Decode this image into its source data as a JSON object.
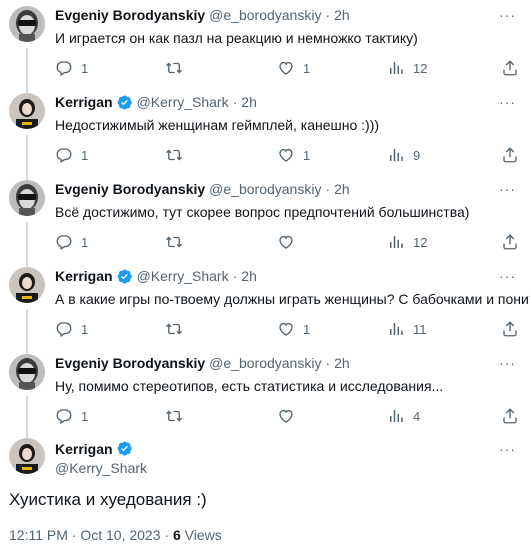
{
  "users": {
    "evgeniy": {
      "name": "Evgeniy Borodyanskiy",
      "handle": "@e_borodyanskiy"
    },
    "kerrigan": {
      "name": "Kerrigan",
      "handle": "@Kerry_Shark"
    }
  },
  "replies": [
    {
      "name": "Evgeniy Borodyanskiy",
      "handle": "@e_borodyanskiy",
      "dot": "·",
      "time": "2h",
      "text": "И играется он как пазл на реакцию и немножко тактику)",
      "replies": "1",
      "retweets": "",
      "likes": "1",
      "views": "12"
    },
    {
      "name": "Kerrigan",
      "handle": "@Kerry_Shark",
      "dot": "·",
      "time": "2h",
      "text": "Недостижимый женщинам геймплей, канешно :)))",
      "replies": "1",
      "retweets": "",
      "likes": "1",
      "views": "9"
    },
    {
      "name": "Evgeniy Borodyanskiy",
      "handle": "@e_borodyanskiy",
      "dot": "·",
      "time": "2h",
      "text": "Всё достижимо, тут скорее вопрос предпочтений большинства)",
      "replies": "1",
      "retweets": "",
      "likes": "",
      "views": "12"
    },
    {
      "name": "Kerrigan",
      "handle": "@Kerry_Shark",
      "dot": "·",
      "time": "2h",
      "text": "А в какие игры по-твоему должны играть женщины? С бабочками и пони?",
      "replies": "1",
      "retweets": "",
      "likes": "1",
      "views": "11"
    },
    {
      "name": "Evgeniy Borodyanskiy",
      "handle": "@e_borodyanskiy",
      "dot": "·",
      "time": "2h",
      "text": "Ну, помимо стереотипов, есть статистика и исследования...",
      "replies": "1",
      "retweets": "",
      "likes": "",
      "views": "4"
    }
  ],
  "main_tweet": {
    "name": "Kerrigan",
    "handle": "@Kerry_Shark",
    "text": "Хуистика и хуедования :)",
    "time": "12:11 PM",
    "date": "Oct 10, 2023",
    "meta_dot": "·",
    "views_count": "6",
    "views_label": "Views"
  },
  "more_label": "···",
  "icons": [
    "reply-icon",
    "retweet-icon",
    "like-icon",
    "views-icon",
    "share-icon",
    "verified-badge-icon",
    "more-icon"
  ],
  "colors": {
    "text": "#0f1419",
    "secondary": "#536471",
    "verified": "#1d9bf0",
    "thread_line": "#cfd9de"
  }
}
